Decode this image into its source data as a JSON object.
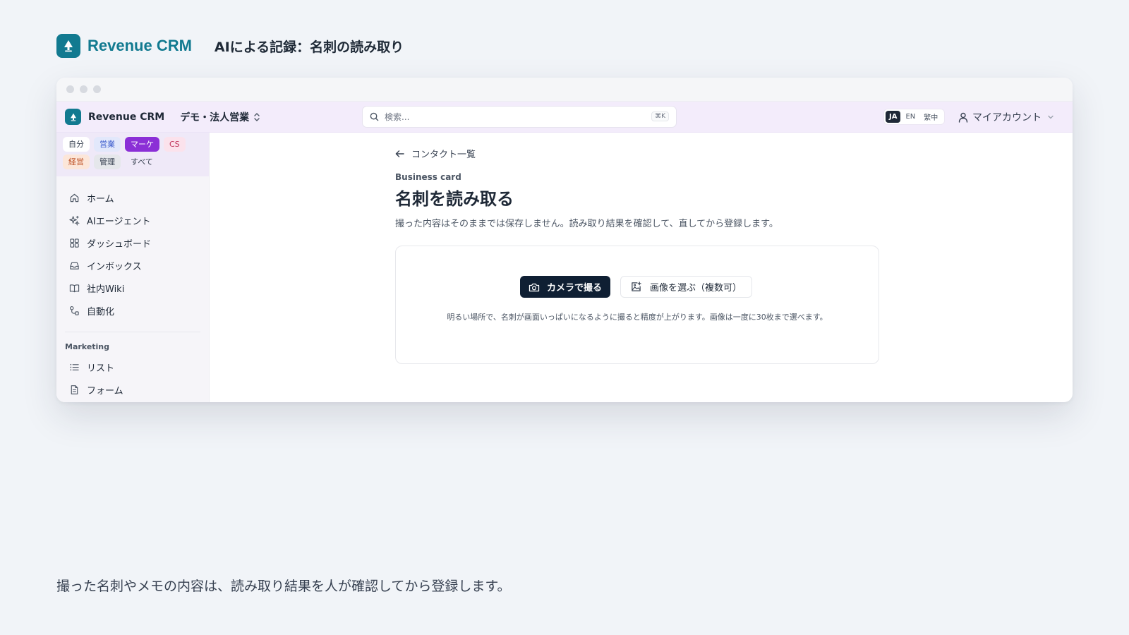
{
  "slide": {
    "brand": "Revenue CRM",
    "title": "AIによる記録：名刺の読み取り",
    "caption": "撮った名刺やメモの内容は、読み取り結果を人が確認してから登録します。"
  },
  "appbar": {
    "app_name": "Revenue CRM",
    "workspace": "デモ・法人営業",
    "search_placeholder": "検索...",
    "search_shortcut": "⌘K",
    "languages": [
      "JA",
      "EN",
      "繁中"
    ],
    "active_language": "JA",
    "account": "マイアカウント"
  },
  "sidebar": {
    "chips_row1": [
      "自分",
      "営業",
      "マーケ",
      "CS"
    ],
    "chips_row2": [
      "経営",
      "管理",
      "すべて"
    ],
    "nav": [
      {
        "label": "ホーム",
        "icon": "home-icon"
      },
      {
        "label": "AIエージェント",
        "icon": "sparkle-icon"
      },
      {
        "label": "ダッシュボード",
        "icon": "dashboard-icon"
      },
      {
        "label": "インボックス",
        "icon": "inbox-icon"
      },
      {
        "label": "社内Wiki",
        "icon": "book-icon"
      },
      {
        "label": "自動化",
        "icon": "workflow-icon"
      }
    ],
    "section_label": "Marketing",
    "marketing_nav": [
      {
        "label": "リスト",
        "icon": "list-icon"
      },
      {
        "label": "フォーム",
        "icon": "form-icon"
      }
    ]
  },
  "main": {
    "back_label": "コンタクト一覧",
    "eyebrow": "Business card",
    "title": "名刺を読み取る",
    "description": "撮った内容はそのままでは保存しません。読み取り結果を確認して、直してから登録します。",
    "camera_button": "カメラで撮る",
    "image_button": "画像を選ぶ（複数可）",
    "hint": "明るい場所で、名刺が画面いっぱいになるように撮ると精度が上がります。画像は一度に30枚まで選べます。"
  },
  "colors": {
    "brand": "#127a90",
    "appbar_bg": "#f3ecfb",
    "primary_button": "#0f1f33",
    "marketing_chip": "#8b2fd6"
  }
}
